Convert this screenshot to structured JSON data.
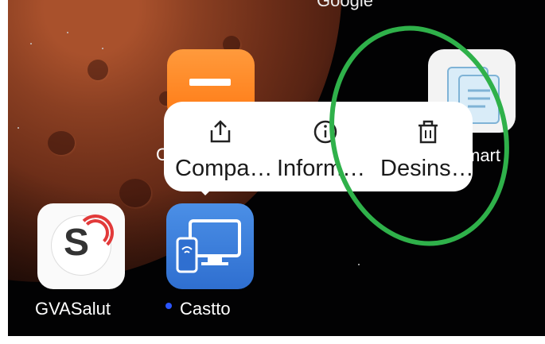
{
  "home": {
    "top_label": "Google",
    "partial_label": "C",
    "apps": [
      {
        "name": "GVASalut",
        "label": "GVASalut"
      },
      {
        "name": "Castto",
        "label": "Castto"
      },
      {
        "name": "smart",
        "label": "mart"
      }
    ]
  },
  "popup": {
    "items": [
      {
        "label": "Compa…",
        "icon": "share-icon"
      },
      {
        "label": "Inform…",
        "icon": "info-icon"
      },
      {
        "label": "Desins…",
        "icon": "trash-icon"
      }
    ]
  },
  "colors": {
    "annotation_ring": "#2fb14a",
    "notification_dot": "#2b55ff"
  }
}
